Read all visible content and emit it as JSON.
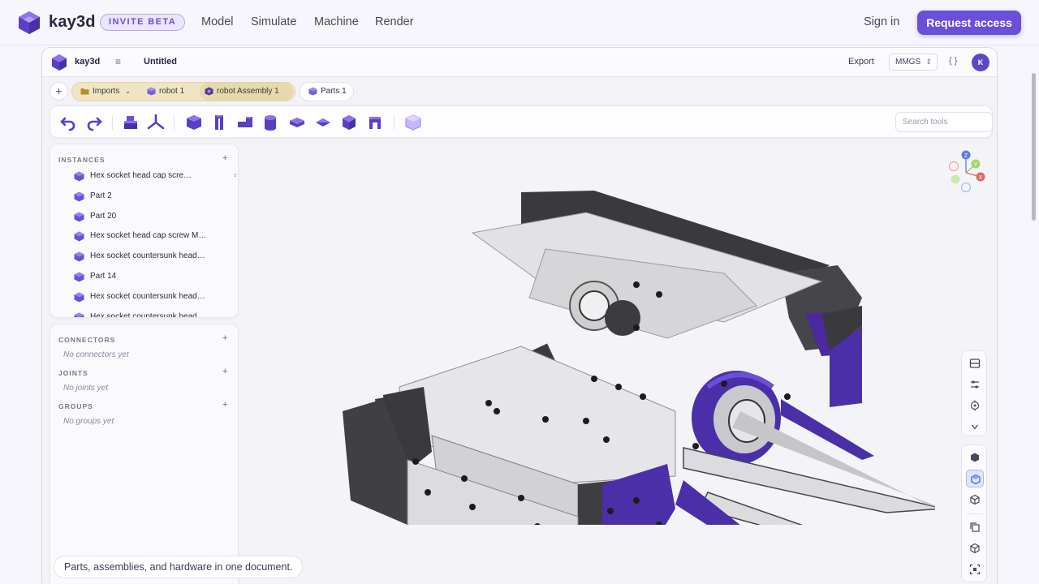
{
  "site": {
    "brand": "kay3d",
    "badge": "INVITE BETA",
    "nav": [
      "Model",
      "Simulate",
      "Machine",
      "Render"
    ],
    "sign_in": "Sign in",
    "request_access": "Request access",
    "accent": "#6a4fd9"
  },
  "app": {
    "name": "kay3d",
    "doc_title": "Untitled",
    "export": "Export",
    "units": "MMGS",
    "json_toggle": "{ }",
    "avatar_initial": "K"
  },
  "tabs": {
    "add": "+",
    "items": [
      {
        "label": "Imports",
        "icon": "folder-icon",
        "has_dropdown": true
      },
      {
        "label": "robot 1",
        "icon": "cube-icon"
      },
      {
        "label": "robot Assembly 1",
        "icon": "assembly-icon"
      },
      {
        "label": "Parts 1",
        "icon": "cube-icon",
        "selected": true
      }
    ]
  },
  "toolbar": {
    "search_placeholder": "Search tools",
    "icons": [
      "undo-icon",
      "redo-icon",
      "assembly-tool-icon",
      "axes-tool-icon",
      "box-tool-icon",
      "channel-tool-icon",
      "l-bracket-tool-icon",
      "cylinder-tool-icon",
      "plate-tool-icon",
      "wedge-tool-icon",
      "sphere-tool-icon",
      "profile-tool-icon",
      "ghost-cube-tool-icon"
    ]
  },
  "instances": {
    "title": "INSTANCES",
    "add": "+",
    "items": [
      {
        "label": "Hex socket head cap scre…",
        "pinned": true
      },
      {
        "label": "Part 2"
      },
      {
        "label": "Part 20"
      },
      {
        "label": "Hex socket head cap screw M…"
      },
      {
        "label": "Hex socket countersunk head…"
      },
      {
        "label": "Part 14"
      },
      {
        "label": "Hex socket countersunk head…"
      },
      {
        "label": "Hex socket countersunk head…"
      }
    ]
  },
  "connectors": {
    "title": "CONNECTORS",
    "add": "+",
    "empty": "No connectors yet"
  },
  "joints": {
    "title": "JOINTS",
    "add": "+",
    "empty": "No joints yet"
  },
  "groups": {
    "title": "GROUPS",
    "add": "+",
    "empty": "No groups yet"
  },
  "caption": "Parts, assemblies, and hardware in one document.",
  "gizmo": {
    "axes": [
      "Z",
      "Y",
      "X"
    ]
  },
  "right_rail": {
    "view_tools": [
      "panel-icon",
      "settings-sliders-icon",
      "target-icon",
      "collapse-chevron-icon"
    ],
    "display_modes": [
      "solid-hex-icon",
      "shaded-cube-icon",
      "wire-cube-icon",
      "copy-icon",
      "box-icon",
      "focus-frame-icon"
    ],
    "active_mode": "shaded-cube-icon"
  }
}
